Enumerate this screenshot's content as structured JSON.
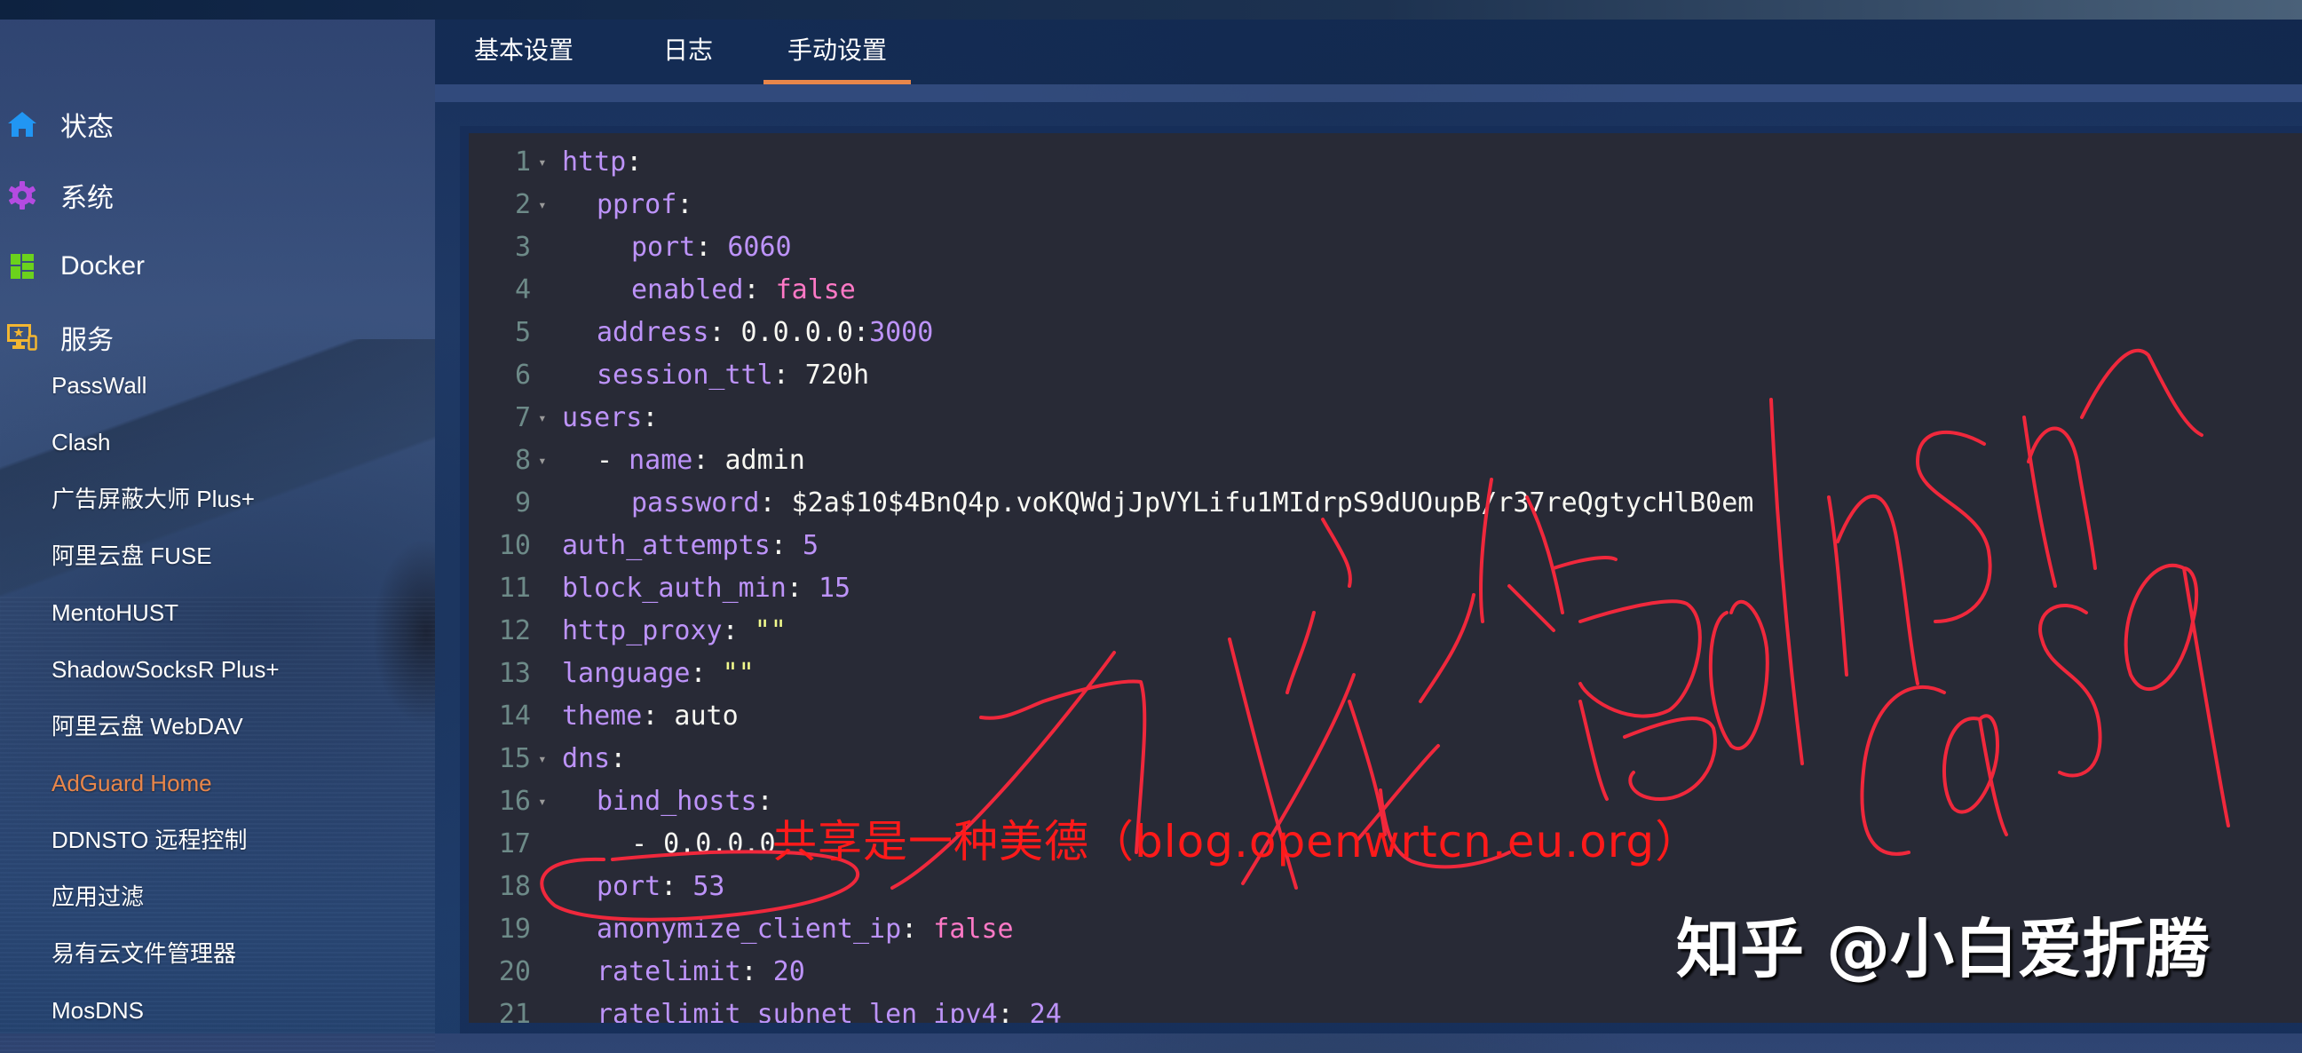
{
  "sidebar": {
    "main_items": [
      {
        "label": "状态",
        "icon": "home-icon",
        "color": "#2196f3"
      },
      {
        "label": "系统",
        "icon": "gear-icon",
        "color": "#b44be1"
      },
      {
        "label": "Docker",
        "icon": "grid-icon",
        "color": "#6bd21c"
      },
      {
        "label": "服务",
        "icon": "devices-icon",
        "color": "#f2b632"
      }
    ],
    "service_items": [
      {
        "label": "PassWall",
        "active": false
      },
      {
        "label": "Clash",
        "active": false
      },
      {
        "label": "广告屏蔽大师 Plus+",
        "active": false
      },
      {
        "label": "阿里云盘 FUSE",
        "active": false
      },
      {
        "label": "MentoHUST",
        "active": false
      },
      {
        "label": "ShadowSocksR Plus+",
        "active": false
      },
      {
        "label": "阿里云盘 WebDAV",
        "active": false
      },
      {
        "label": "AdGuard Home",
        "active": true
      },
      {
        "label": "DDNSTO 远程控制",
        "active": false
      },
      {
        "label": "应用过滤",
        "active": false
      },
      {
        "label": "易有云文件管理器",
        "active": false
      },
      {
        "label": "MosDNS",
        "active": false
      }
    ],
    "active_color": "#e8864a"
  },
  "tabs": [
    {
      "label": "基本设置",
      "active": false
    },
    {
      "label": "日志",
      "active": false
    },
    {
      "label": "手动设置",
      "active": true
    }
  ],
  "editor": {
    "lines": [
      {
        "n": "1",
        "fold": true,
        "indent": 0,
        "tokens": [
          [
            "k",
            "http"
          ],
          [
            "p",
            ":"
          ]
        ]
      },
      {
        "n": "2",
        "fold": true,
        "indent": 1,
        "tokens": [
          [
            "k",
            "pprof"
          ],
          [
            "p",
            ":"
          ]
        ]
      },
      {
        "n": "3",
        "fold": false,
        "indent": 2,
        "tokens": [
          [
            "k",
            "port"
          ],
          [
            "p",
            ": "
          ],
          [
            "n",
            "6060"
          ]
        ]
      },
      {
        "n": "4",
        "fold": false,
        "indent": 2,
        "tokens": [
          [
            "k",
            "enabled"
          ],
          [
            "p",
            ": "
          ],
          [
            "b",
            "false"
          ]
        ]
      },
      {
        "n": "5",
        "fold": false,
        "indent": 1,
        "tokens": [
          [
            "k",
            "address"
          ],
          [
            "p",
            ": 0.0.0.0:"
          ],
          [
            "n",
            "3000"
          ]
        ]
      },
      {
        "n": "6",
        "fold": false,
        "indent": 1,
        "tokens": [
          [
            "k",
            "session_ttl"
          ],
          [
            "p",
            ": 720h"
          ]
        ]
      },
      {
        "n": "7",
        "fold": true,
        "indent": 0,
        "tokens": [
          [
            "k",
            "users"
          ],
          [
            "p",
            ":"
          ]
        ]
      },
      {
        "n": "8",
        "fold": true,
        "indent": 1,
        "tokens": [
          [
            "p",
            "- "
          ],
          [
            "k",
            "name"
          ],
          [
            "p",
            ": admin"
          ]
        ]
      },
      {
        "n": "9",
        "fold": false,
        "indent": 2,
        "tokens": [
          [
            "k",
            "password"
          ],
          [
            "p",
            ": $2a$10$4BnQ4p.voKQWdjJpVYLifu1MIdrpS9dUOupB/r37reQgtycHlB0em"
          ]
        ]
      },
      {
        "n": "10",
        "fold": false,
        "indent": 0,
        "tokens": [
          [
            "k",
            "auth_attempts"
          ],
          [
            "p",
            ": "
          ],
          [
            "n",
            "5"
          ]
        ]
      },
      {
        "n": "11",
        "fold": false,
        "indent": 0,
        "tokens": [
          [
            "k",
            "block_auth_min"
          ],
          [
            "p",
            ": "
          ],
          [
            "n",
            "15"
          ]
        ]
      },
      {
        "n": "12",
        "fold": false,
        "indent": 0,
        "tokens": [
          [
            "k",
            "http_proxy"
          ],
          [
            "p",
            ": "
          ],
          [
            "s",
            "\"\""
          ]
        ]
      },
      {
        "n": "13",
        "fold": false,
        "indent": 0,
        "tokens": [
          [
            "k",
            "language"
          ],
          [
            "p",
            ": "
          ],
          [
            "s",
            "\"\""
          ]
        ]
      },
      {
        "n": "14",
        "fold": false,
        "indent": 0,
        "tokens": [
          [
            "k",
            "theme"
          ],
          [
            "p",
            ": auto"
          ]
        ]
      },
      {
        "n": "15",
        "fold": true,
        "indent": 0,
        "tokens": [
          [
            "k",
            "dns"
          ],
          [
            "p",
            ":"
          ]
        ]
      },
      {
        "n": "16",
        "fold": true,
        "indent": 1,
        "tokens": [
          [
            "k",
            "bind_hosts"
          ],
          [
            "p",
            ":"
          ]
        ]
      },
      {
        "n": "17",
        "fold": false,
        "indent": 2,
        "tokens": [
          [
            "p",
            "- 0.0.0.0"
          ]
        ]
      },
      {
        "n": "18",
        "fold": false,
        "indent": 1,
        "tokens": [
          [
            "k",
            "port"
          ],
          [
            "p",
            ": "
          ],
          [
            "n",
            "53"
          ]
        ]
      },
      {
        "n": "19",
        "fold": false,
        "indent": 1,
        "tokens": [
          [
            "k",
            "anonymize_client_ip"
          ],
          [
            "p",
            ": "
          ],
          [
            "b",
            "false"
          ]
        ]
      },
      {
        "n": "20",
        "fold": false,
        "indent": 1,
        "tokens": [
          [
            "k",
            "ratelimit"
          ],
          [
            "p",
            ": "
          ],
          [
            "n",
            "20"
          ]
        ]
      },
      {
        "n": "21",
        "fold": false,
        "indent": 1,
        "tokens": [
          [
            "k",
            "ratelimit_subnet_len_ipv4"
          ],
          [
            "p",
            ": "
          ],
          [
            "n",
            "24"
          ]
        ]
      }
    ],
    "fold_glyph": "▾"
  },
  "annotations": {
    "share_text": "共享是一种美德（blog.openwrtcn.eu.org）",
    "watermark": "知乎 @小白爱折腾",
    "handwriting": "→ 接管 dns in casa",
    "ink_color": "#f0283c"
  }
}
